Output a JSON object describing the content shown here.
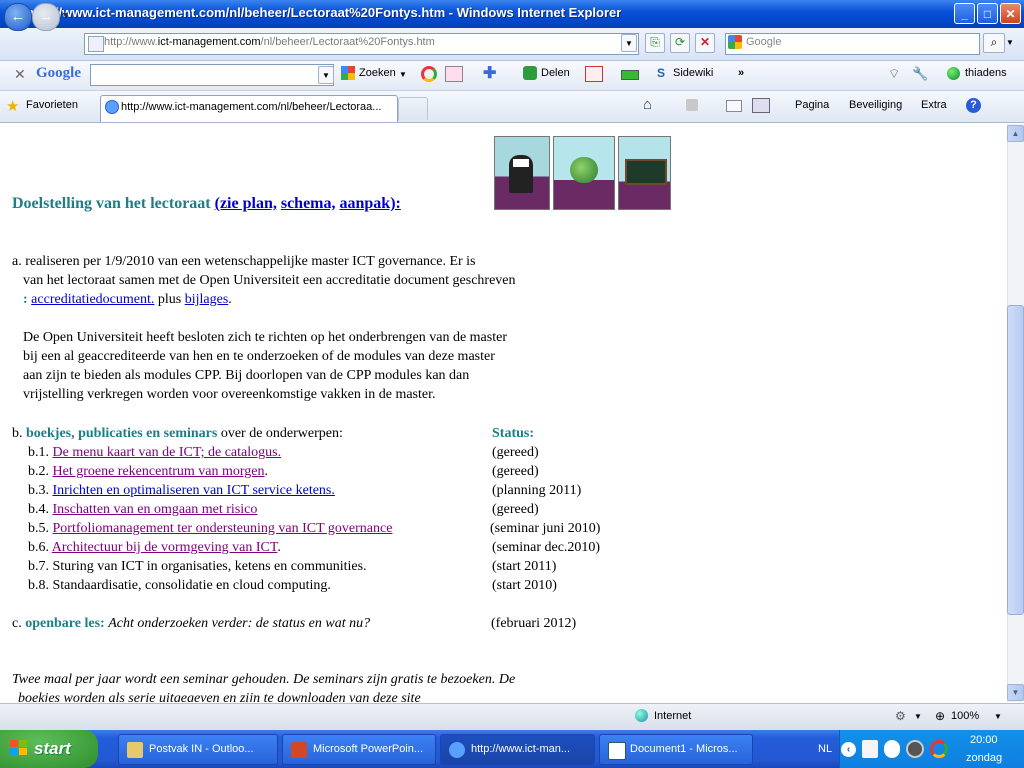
{
  "window": {
    "title": "http://www.ict-management.com/nl/beheer/Lectoraat%20Fontys.htm - Windows Internet Explorer",
    "min": "_",
    "max": "□",
    "close": "✕"
  },
  "address": {
    "prefix": "http://www.",
    "domain": "ict-management.com",
    "suffix": "/nl/beheer/Lectoraat%20Fontys.htm",
    "search_placeholder": "Google"
  },
  "google_toolbar": {
    "brand": "Google",
    "search_label": "Zoeken",
    "share_label": "Delen",
    "sidewiki_label": "Sidewiki",
    "user": "thiadens"
  },
  "favorites_bar": {
    "favorites_label": "Favorieten",
    "tab_title": "http://www.ict-management.com/nl/beheer/Lectoraa...",
    "pagina": "Pagina",
    "beveiliging": "Beveiliging",
    "extra": "Extra"
  },
  "content": {
    "heading": "Doelstelling van het lectoraat",
    "heading_links": {
      "open": "(zie plan,",
      "schema": "schema,",
      "aanpak": "aanpak):"
    },
    "a_letter": "a.",
    "a_lines": [
      "realiseren per 1/9/2010 van een wetenschappelijke master ICT governance. Er is",
      "van het lectoraat samen met de Open Universiteit een accreditatie document geschreven"
    ],
    "a_colon": ":",
    "a_link1": "accreditatiedocument.",
    "a_plus": "plus",
    "a_link2": "bijlages",
    "a_dot": ".",
    "ou_lines": [
      "De Open Universiteit heeft besloten zich te richten op het onderbrengen van de master",
      "bij een al geaccrediteerde van hen en te onderzoeken of de modules van deze master",
      "aan zijn te bieden als modules CPP. Bij doorlopen van de CPP modules kan dan",
      "vrijstelling verkregen worden voor overeenkomstige vakken in de master."
    ],
    "b_letter": "b.",
    "b_title": "boekjes, publicaties en seminars",
    "b_rest": "over de onderwerpen:",
    "status_header": "Status:",
    "items": [
      {
        "num": "b.1.",
        "text": "De menu kaart van de ICT; de catalogus.",
        "status": "(gereed)"
      },
      {
        "num": "b.2.",
        "text": "Het groene rekencentrum van morgen",
        "tail": ".",
        "status": "(gereed)"
      },
      {
        "num": "b.3.",
        "text": "Inrichten en optimaliseren van ICT service ketens.",
        "status": "(planning 2011)"
      },
      {
        "num": "b.4.",
        "text": "Inschatten van en omgaan met risico",
        "status": "(gereed)"
      },
      {
        "num": "b.5.",
        "text": "Portfoliomanagement ter ondersteuning van ICT governance ",
        "status": "(seminar juni 2010)"
      },
      {
        "num": "b.6.",
        "text": "Architectuur bij de vormgeving van ICT",
        "tail": ".",
        "status": "(seminar dec.2010)"
      },
      {
        "num": "b.7.",
        "text": "Sturing van ICT in organisaties, ketens en communities.",
        "status": "(start 2011)"
      },
      {
        "num": "b.8.",
        "text": "Standaardisatie, consolidatie en cloud computing.",
        "status": "(start 2010)"
      }
    ],
    "c_letter": "c.",
    "c_title": "openbare les:",
    "c_text": "Acht onderzoeken verder: de status en wat nu?",
    "c_status": "(februari 2012)",
    "footer_line1": "Twee maal per jaar wordt een seminar gehouden. De seminars zijn gratis te bezoeken. De",
    "footer_line2": "boekjes worden als serie uitgegeven en zijn te downloaden van deze site"
  },
  "statusbar": {
    "zone": "Internet",
    "zoom": "100%"
  },
  "taskbar": {
    "start": "start",
    "tasks": [
      "Postvak IN - Outloo...",
      "Microsoft PowerPoin...",
      "http://www.ict-man...",
      "Document1 - Micros..."
    ],
    "lang": "NL",
    "time": "20:00",
    "day": "zondag"
  }
}
